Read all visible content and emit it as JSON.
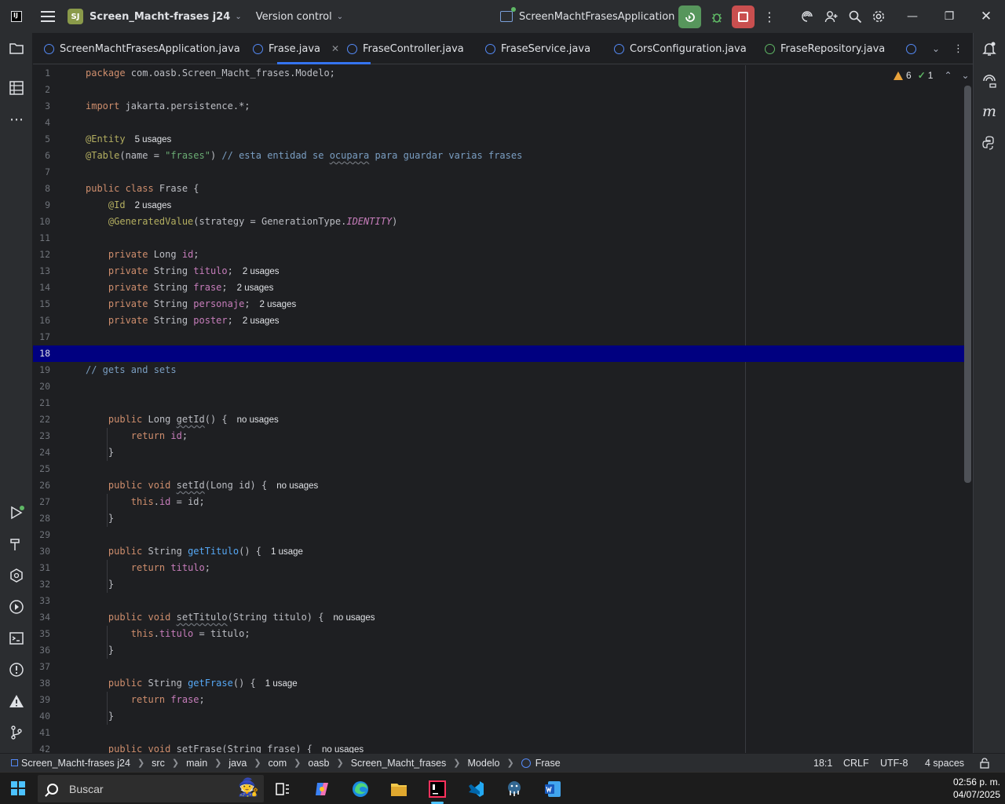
{
  "titlebar": {
    "project_initials": "SJ",
    "project_name": "Screen_Macht-frases j24",
    "version_control": "Version control",
    "run_config": "ScreenMachtFrasesApplication"
  },
  "tabs": [
    {
      "label": "ScreenMachtFrasesApplication.java",
      "kind": "class"
    },
    {
      "label": "Frase.java",
      "kind": "class",
      "active": true
    },
    {
      "label": "FraseController.java",
      "kind": "class"
    },
    {
      "label": "FraseService.java",
      "kind": "class"
    },
    {
      "label": "CorsConfiguration.java",
      "kind": "class"
    },
    {
      "label": "FraseRepository.java",
      "kind": "interface"
    }
  ],
  "inspections": {
    "warnings": "6",
    "weak_warnings": "1"
  },
  "editor": {
    "current_line": 18,
    "lines": [
      {
        "n": "1",
        "html": "<span class='kw'>package</span> com.oasb.Screen_Macht_frases.Modelo;"
      },
      {
        "n": "2",
        "html": ""
      },
      {
        "n": "3",
        "html": "<span class='kw'>import</span> jakarta.persistence.*;"
      },
      {
        "n": "4",
        "html": ""
      },
      {
        "n": "5",
        "html": "<span class='ann'>@Entity</span>",
        "hint": "5 usages"
      },
      {
        "n": "6",
        "html": "<span class='ann'>@Table</span>(name = <span class='str'>\"frases\"</span>) <span class='cmt'>// esta entidad se <span class='wavy'>ocupara</span> para guardar varias frases</span>"
      },
      {
        "n": "7",
        "html": ""
      },
      {
        "n": "8",
        "html": "<span class='kw'>public class</span> Frase {"
      },
      {
        "n": "9",
        "html": "    <span class='ann'>@Id</span>",
        "hint": "2 usages"
      },
      {
        "n": "10",
        "html": "    <span class='ann'>@GeneratedValue</span>(strategy = GenerationType.<span class='ital'>IDENTITY</span>)"
      },
      {
        "n": "11",
        "html": ""
      },
      {
        "n": "12",
        "html": "    <span class='kw'>private</span> Long <span class='fld'>id</span>;"
      },
      {
        "n": "13",
        "html": "    <span class='kw'>private</span> String <span class='fld'>titulo</span>;",
        "hint": "2 usages"
      },
      {
        "n": "14",
        "html": "    <span class='kw'>private</span> String <span class='fld'>frase</span>;",
        "hint": "2 usages"
      },
      {
        "n": "15",
        "html": "    <span class='kw'>private</span> String <span class='fld'>personaje</span>;",
        "hint": "2 usages"
      },
      {
        "n": "16",
        "html": "    <span class='kw'>private</span> String <span class='fld'>poster</span>;",
        "hint": "2 usages"
      },
      {
        "n": "17",
        "html": ""
      },
      {
        "n": "18",
        "html": ""
      },
      {
        "n": "19",
        "html": "<span class='cmt'>// gets and sets</span>"
      },
      {
        "n": "20",
        "html": ""
      },
      {
        "n": "21",
        "html": ""
      },
      {
        "n": "22",
        "html": "    <span class='kw'>public</span> Long <span class='wavy'>getId</span>() {",
        "hint": "no usages"
      },
      {
        "n": "23",
        "html": "        <span class='kw'>return</span> <span class='fld'>id</span>;"
      },
      {
        "n": "24",
        "html": "    }"
      },
      {
        "n": "25",
        "html": ""
      },
      {
        "n": "26",
        "html": "    <span class='kw'>public void</span> <span class='wavy'>setId</span>(Long id) {",
        "hint": "no usages"
      },
      {
        "n": "27",
        "html": "        <span class='kw'>this</span>.<span class='fld'>id</span> = id;"
      },
      {
        "n": "28",
        "html": "    }"
      },
      {
        "n": "29",
        "html": ""
      },
      {
        "n": "30",
        "html": "    <span class='kw'>public</span> String <span class='fn'>getTitulo</span>() {",
        "hint": "1 usage"
      },
      {
        "n": "31",
        "html": "        <span class='kw'>return</span> <span class='fld'>titulo</span>;"
      },
      {
        "n": "32",
        "html": "    }"
      },
      {
        "n": "33",
        "html": ""
      },
      {
        "n": "34",
        "html": "    <span class='kw'>public void</span> <span class='wavy'>setTitulo</span>(String titulo) {",
        "hint": "no usages"
      },
      {
        "n": "35",
        "html": "        <span class='kw'>this</span>.<span class='fld'>titulo</span> = titulo;"
      },
      {
        "n": "36",
        "html": "    }"
      },
      {
        "n": "37",
        "html": ""
      },
      {
        "n": "38",
        "html": "    <span class='kw'>public</span> String <span class='fn'>getFrase</span>() {",
        "hint": "1 usage"
      },
      {
        "n": "39",
        "html": "        <span class='kw'>return</span> <span class='fld'>frase</span>;"
      },
      {
        "n": "40",
        "html": "    }"
      },
      {
        "n": "41",
        "html": ""
      },
      {
        "n": "42",
        "html": "    <span class='kw'>public void</span> <span class='wavy'>setFrase</span>(String frase) {",
        "hint": "no usages"
      }
    ]
  },
  "statusbar": {
    "breadcrumbs": [
      "Screen_Macht-frases j24",
      "src",
      "main",
      "java",
      "com",
      "oasb",
      "Screen_Macht_frases",
      "Modelo",
      "Frase"
    ],
    "position": "18:1",
    "line_ending": "CRLF",
    "encoding": "UTF-8",
    "indent": "4 spaces"
  },
  "taskbar": {
    "search_placeholder": "Buscar",
    "time": "02:56 p. m.",
    "date": "04/07/2025"
  },
  "colors": {
    "accent": "#3574f0",
    "run_green": "#57965c",
    "stop_red": "#c94f4f",
    "current_line": "#000080"
  }
}
